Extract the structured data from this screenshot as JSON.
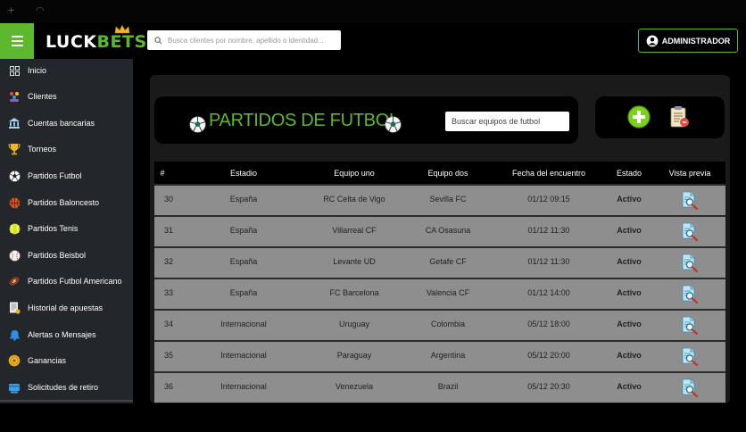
{
  "brand": {
    "luck": "LUCK",
    "bets": "BETS",
    "accent_color": "#5cb82e"
  },
  "topbar": {
    "menu_icon": "hamburger-icon",
    "search_placeholder": "Busca clientes por nombre, apellido o identidad...",
    "admin_label": "ADMINISTRADOR"
  },
  "sidebar": {
    "items": [
      {
        "label": "Inicio",
        "icon": "grid-icon"
      },
      {
        "label": "Clientes",
        "icon": "users-icon"
      },
      {
        "label": "Cuentas bancarias",
        "icon": "bank-icon"
      },
      {
        "label": "Torneos",
        "icon": "trophy-icon"
      },
      {
        "label": "Partidos Futbol",
        "icon": "soccer-ball-icon"
      },
      {
        "label": "Partidos Baloncesto",
        "icon": "basketball-icon"
      },
      {
        "label": "Partidos Tenis",
        "icon": "tennis-ball-icon"
      },
      {
        "label": "Partidos Beisbol",
        "icon": "baseball-icon"
      },
      {
        "label": "Partidos Futbol Americano",
        "icon": "football-icon"
      },
      {
        "label": "Historial de apuestas",
        "icon": "history-icon"
      },
      {
        "label": "Alertas o Mensajes",
        "icon": "bell-icon"
      },
      {
        "label": "Ganancias",
        "icon": "coins-icon"
      },
      {
        "label": "Solicitudes de retiro",
        "icon": "withdraw-icon"
      }
    ]
  },
  "page": {
    "title": "PARTIDOS DE FUTBOL",
    "team_search_placeholder": "Buscar equipos de futbol",
    "actions": [
      {
        "icon": "add-icon"
      },
      {
        "icon": "clipboard-report-icon"
      }
    ]
  },
  "table": {
    "columns": [
      "#",
      "Estadio",
      "Equipo uno",
      "Equipo dos",
      "Fecha del encuentro",
      "Estado",
      "Vista previa"
    ],
    "rows": [
      {
        "id": "30",
        "estadio": "España",
        "equipo_uno": "RC Celta de Vigo",
        "equipo_dos": "Sevilla FC",
        "fecha": "01/12 09:15",
        "estado": "Activo"
      },
      {
        "id": "31",
        "estadio": "España",
        "equipo_uno": "Villarreal CF",
        "equipo_dos": "CA Osasuna",
        "fecha": "01/12 11:30",
        "estado": "Activo"
      },
      {
        "id": "32",
        "estadio": "España",
        "equipo_uno": "Levante UD",
        "equipo_dos": "Getafe CF",
        "fecha": "01/12 11:30",
        "estado": "Activo"
      },
      {
        "id": "33",
        "estadio": "España",
        "equipo_uno": "FC Barcelona",
        "equipo_dos": "Valencia CF",
        "fecha": "01/12 14:00",
        "estado": "Activo"
      },
      {
        "id": "34",
        "estadio": "Internacional",
        "equipo_uno": "Uruguay",
        "equipo_dos": "Colombia",
        "fecha": "05/12 18:00",
        "estado": "Activo"
      },
      {
        "id": "35",
        "estadio": "Internacional",
        "equipo_uno": "Paraguay",
        "equipo_dos": "Argentina",
        "fecha": "05/12 20:00",
        "estado": "Activo"
      },
      {
        "id": "36",
        "estadio": "Internacional",
        "equipo_uno": "Venezuela",
        "equipo_dos": "Brazil",
        "fecha": "05/12 20:30",
        "estado": "Activo"
      }
    ],
    "preview_icon": "preview-search-icon"
  }
}
